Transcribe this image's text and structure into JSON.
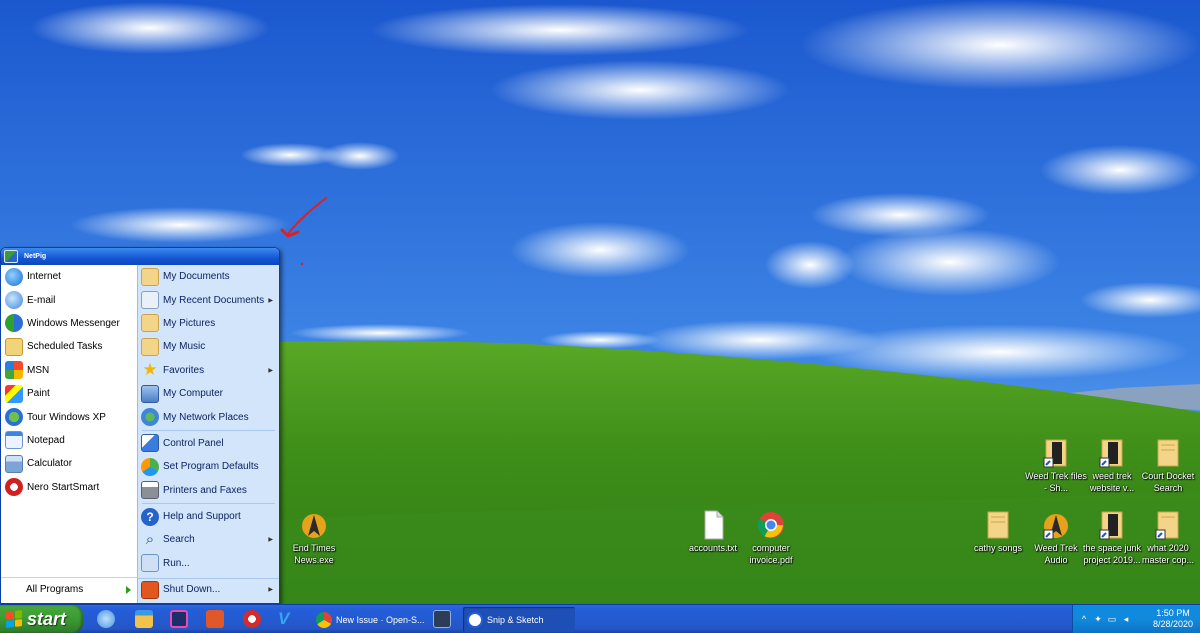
{
  "colors": {
    "sky_top": "#1f5fd0",
    "sky_bottom": "#5aa0e8",
    "grass": "#3d8f1e",
    "start_green": "#3c9a34",
    "taskbar_blue": "#245edc",
    "annotation_red": "#e02020"
  },
  "start_menu": {
    "user_name": "NetPig",
    "left_items": [
      {
        "label": "Internet",
        "icon": "internet-explorer-icon"
      },
      {
        "label": "E-mail",
        "icon": "email-icon"
      },
      {
        "label": "Windows Messenger",
        "icon": "messenger-icon"
      },
      {
        "label": "Scheduled Tasks",
        "icon": "scheduled-tasks-icon"
      },
      {
        "label": "MSN",
        "icon": "msn-butterfly-icon"
      },
      {
        "label": "Paint",
        "icon": "paint-icon"
      },
      {
        "label": "Tour Windows XP",
        "icon": "tour-icon"
      },
      {
        "label": "Notepad",
        "icon": "notepad-icon"
      },
      {
        "label": "Calculator",
        "icon": "calculator-icon"
      },
      {
        "label": "Nero StartSmart",
        "icon": "nero-icon"
      }
    ],
    "all_programs": "All Programs",
    "right_items": [
      {
        "label": "My Documents",
        "icon": "folder-icon"
      },
      {
        "label": "My Recent Documents",
        "icon": "recent-documents-icon",
        "submenu": true
      },
      {
        "label": "My Pictures",
        "icon": "pictures-folder-icon"
      },
      {
        "label": "My Music",
        "icon": "music-folder-icon"
      },
      {
        "label": "Favorites",
        "icon": "star-icon",
        "submenu": true
      },
      {
        "label": "My Computer",
        "icon": "computer-icon"
      },
      {
        "label": "My Network Places",
        "icon": "network-icon"
      },
      {
        "label": "Control Panel",
        "icon": "control-panel-icon"
      },
      {
        "label": "Set Program Defaults",
        "icon": "program-defaults-icon"
      },
      {
        "label": "Printers and Faxes",
        "icon": "printer-icon"
      },
      {
        "label": "Help and Support",
        "icon": "help-icon"
      },
      {
        "label": "Search",
        "icon": "search-icon",
        "submenu": true
      },
      {
        "label": "Run...",
        "icon": "run-icon"
      }
    ],
    "shutdown": "Shut Down..."
  },
  "desktop_icons": [
    {
      "label": "End Times News.exe",
      "icon": "star-trek-icon"
    },
    {
      "label": "accounts.txt",
      "icon": "text-file-icon"
    },
    {
      "label": "computer invoice.pdf",
      "icon": "chrome-icon"
    },
    {
      "label": "Weed Trek files - Sh...",
      "icon": "folder-shortcut-icon"
    },
    {
      "label": "weed trek website v...",
      "icon": "folder-shortcut-icon"
    },
    {
      "label": "Court Docket Search",
      "icon": "folder-icon"
    },
    {
      "label": "cathy songs",
      "icon": "folder-icon"
    },
    {
      "label": "Weed Trek Audio",
      "icon": "star-trek-icon"
    },
    {
      "label": "the space junk project 2019...",
      "icon": "folder-shortcut-icon"
    },
    {
      "label": "what 2020 master cop...",
      "icon": "folder-shortcut-icon"
    }
  ],
  "taskbar": {
    "start_label": "start",
    "tasks": [
      {
        "label": "New Issue · Open-S...",
        "icon": "chrome-icon"
      },
      {
        "label": "Snip & Sketch",
        "icon": "snip-sketch-icon",
        "active": true
      }
    ],
    "time": "1:50 PM",
    "date": "8/28/2020"
  }
}
